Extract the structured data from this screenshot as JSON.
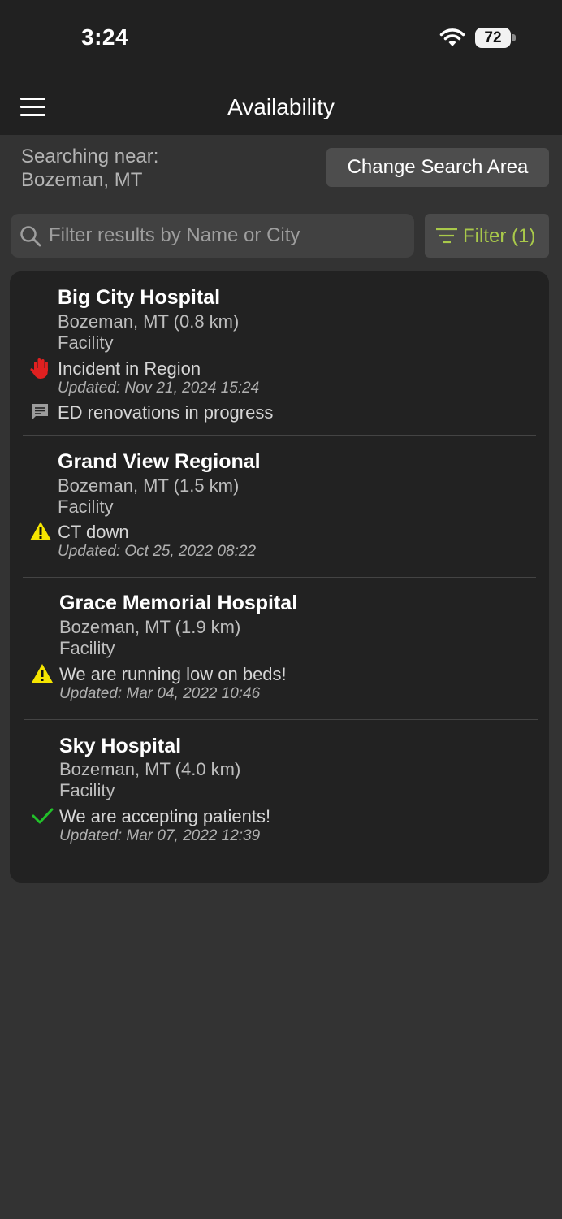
{
  "status_bar": {
    "time": "3:24",
    "battery": "72"
  },
  "nav": {
    "title": "Availability"
  },
  "search_area": {
    "label": "Searching near:",
    "city": "Bozeman, MT",
    "change_button": "Change Search Area"
  },
  "search": {
    "placeholder": "Filter results by Name or City",
    "value": ""
  },
  "filter": {
    "label": "Filter (1)"
  },
  "colors": {
    "accent": "#a9c94a",
    "alert_red": "#e02020",
    "warning_yellow": "#f5e500",
    "ok_green": "#22c02a"
  },
  "facilities": [
    {
      "name": "Big City Hospital",
      "location": "Bozeman, MT (0.8 km)",
      "type": "Facility",
      "status_icon": "stop-hand-icon",
      "status": "Incident in Region",
      "updated": "Updated: Nov 21, 2024 15:24",
      "note": "ED renovations in progress"
    },
    {
      "name": "Grand View Regional",
      "location": "Bozeman, MT (1.5 km)",
      "type": "Facility",
      "status_icon": "warning-icon",
      "status": "CT down",
      "updated": "Updated: Oct 25, 2022 08:22"
    },
    {
      "name": "Grace Memorial Hospital",
      "location": "Bozeman, MT (1.9 km)",
      "type": "Facility",
      "status_icon": "warning-icon",
      "status": "We are running low on beds!",
      "updated": "Updated: Mar 04, 2022 10:46"
    },
    {
      "name": "Sky Hospital",
      "location": "Bozeman, MT (4.0 km)",
      "type": "Facility",
      "status_icon": "checkmark-icon",
      "status": "We are accepting patients!",
      "updated": "Updated: Mar 07, 2022 12:39"
    }
  ]
}
